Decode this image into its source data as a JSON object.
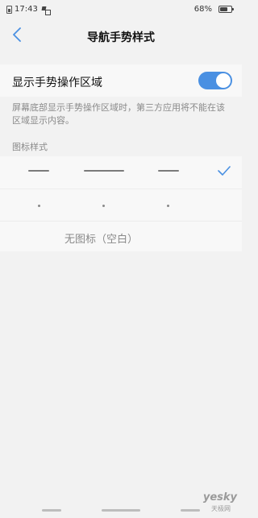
{
  "status_bar": {
    "time": "17:43",
    "battery_percent": "68%",
    "battery_level": 0.68
  },
  "nav": {
    "title": "导航手势样式",
    "back_icon": "chevron-left-icon"
  },
  "gesture_toggle": {
    "label": "显示手势操作区域",
    "enabled": true,
    "accent": "#4a90e2"
  },
  "description": "屏幕底部显示手势操作区域时，第三方应用将不能在该区域显示内容。",
  "icon_style": {
    "section_label": "图标样式",
    "options": [
      {
        "name": "lines",
        "selected": true
      },
      {
        "name": "dots",
        "selected": false
      },
      {
        "name": "blank",
        "label": "无图标（空白）",
        "selected": false
      }
    ]
  },
  "watermark": {
    "text": "yesky",
    "sub": "天极网"
  }
}
